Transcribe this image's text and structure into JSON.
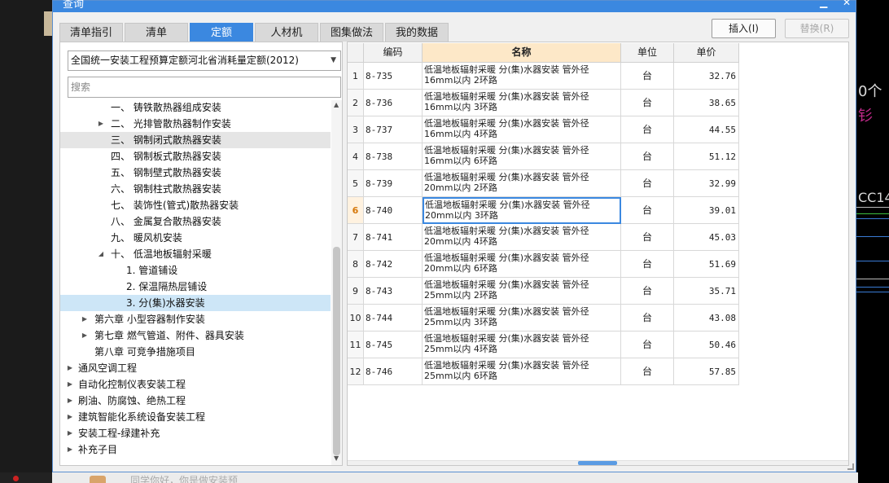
{
  "window": {
    "title": "查询"
  },
  "tabs": [
    {
      "label": "清单指引"
    },
    {
      "label": "清单"
    },
    {
      "label": "定额"
    },
    {
      "label": "人材机"
    },
    {
      "label": "图集做法"
    },
    {
      "label": "我的数据"
    }
  ],
  "active_tab": "定额",
  "buttons": {
    "insert": "插入(I)",
    "replace": "替换(R)"
  },
  "quota_selector": {
    "value": "全国统一安装工程预算定额河北省消耗量定额(2012)"
  },
  "search": {
    "placeholder": "搜索",
    "value": ""
  },
  "tree": [
    {
      "label": "一、 铸铁散热器组成安装",
      "expander": ""
    },
    {
      "label": "二、 光排管散热器制作安装",
      "expander": "collapsed"
    },
    {
      "label": "三、 钢制闭式散热器安装",
      "expander": "",
      "selected": true
    },
    {
      "label": "四、 钢制板式散热器安装",
      "expander": ""
    },
    {
      "label": "五、 钢制壁式散热器安装",
      "expander": ""
    },
    {
      "label": "六、 钢制柱式散热器安装",
      "expander": ""
    },
    {
      "label": "七、 装饰性(管式)散热器安装",
      "expander": ""
    },
    {
      "label": "八、 金属复合散热器安装",
      "expander": ""
    },
    {
      "label": "九、 暖风机安装",
      "expander": ""
    },
    {
      "label": "十、 低温地板辐射采暖",
      "expander": "expanded"
    },
    {
      "label": "1. 管道铺设",
      "expander": ""
    },
    {
      "label": "2. 保温隔热层铺设",
      "expander": ""
    },
    {
      "label": "3. 分(集)水器安装",
      "expander": "",
      "highlighted": true
    },
    {
      "label": "第六章 小型容器制作安装",
      "expander": "collapsed"
    },
    {
      "label": "第七章 燃气管道、附件、器具安装",
      "expander": "collapsed"
    },
    {
      "label": "第八章 可竞争措施项目",
      "expander": ""
    },
    {
      "label": "通风空调工程",
      "expander": "collapsed"
    },
    {
      "label": "自动化控制仪表安装工程",
      "expander": "collapsed"
    },
    {
      "label": "刷油、防腐蚀、绝热工程",
      "expander": "collapsed"
    },
    {
      "label": "建筑智能化系统设备安装工程",
      "expander": "collapsed"
    },
    {
      "label": "安装工程-绿建补充",
      "expander": "collapsed"
    },
    {
      "label": "补充子目",
      "expander": "collapsed"
    }
  ],
  "grid": {
    "columns": [
      {
        "label": ""
      },
      {
        "label": "编码"
      },
      {
        "label": "名称"
      },
      {
        "label": "单位"
      },
      {
        "label": "单价"
      }
    ],
    "current_row": "6",
    "rows": [
      {
        "index": "1",
        "code": "8-735",
        "name1": "低温地板辐射采暖 分(集)水器安装 管外径",
        "name2": "16mm以内 2环路",
        "unit": "台",
        "price": "32.76"
      },
      {
        "index": "2",
        "code": "8-736",
        "name1": "低温地板辐射采暖 分(集)水器安装 管外径",
        "name2": "16mm以内 3环路",
        "unit": "台",
        "price": "38.65"
      },
      {
        "index": "3",
        "code": "8-737",
        "name1": "低温地板辐射采暖 分(集)水器安装 管外径",
        "name2": "16mm以内 4环路",
        "unit": "台",
        "price": "44.55"
      },
      {
        "index": "4",
        "code": "8-738",
        "name1": "低温地板辐射采暖 分(集)水器安装 管外径",
        "name2": "16mm以内 6环路",
        "unit": "台",
        "price": "51.12"
      },
      {
        "index": "5",
        "code": "8-739",
        "name1": "低温地板辐射采暖 分(集)水器安装 管外径",
        "name2": "20mm以内 2环路",
        "unit": "台",
        "price": "32.99"
      },
      {
        "index": "6",
        "code": "8-740",
        "name1": "低温地板辐射采暖 分(集)水器安装 管外径",
        "name2": "20mm以内 3环路",
        "unit": "台",
        "price": "39.01"
      },
      {
        "index": "7",
        "code": "8-741",
        "name1": "低温地板辐射采暖 分(集)水器安装 管外径",
        "name2": "20mm以内 4环路",
        "unit": "台",
        "price": "45.03"
      },
      {
        "index": "8",
        "code": "8-742",
        "name1": "低温地板辐射采暖 分(集)水器安装 管外径",
        "name2": "20mm以内 6环路",
        "unit": "台",
        "price": "51.69"
      },
      {
        "index": "9",
        "code": "8-743",
        "name1": "低温地板辐射采暖 分(集)水器安装 管外径",
        "name2": "25mm以内 2环路",
        "unit": "台",
        "price": "35.71"
      },
      {
        "index": "10",
        "code": "8-744",
        "name1": "低温地板辐射采暖 分(集)水器安装 管外径",
        "name2": "25mm以内 3环路",
        "unit": "台",
        "price": "43.08"
      },
      {
        "index": "11",
        "code": "8-745",
        "name1": "低温地板辐射采暖 分(集)水器安装 管外径",
        "name2": "25mm以内 4环路",
        "unit": "台",
        "price": "50.46"
      },
      {
        "index": "12",
        "code": "8-746",
        "name1": "低温地板辐射采暖 分(集)水器安装 管外径",
        "name2": "25mm以内 6环路",
        "unit": "台",
        "price": "57.85"
      }
    ]
  },
  "background": {
    "right_text_1": "0个",
    "right_text_2": "钐",
    "right_text_3": "CC14",
    "chat_text": "同学你好，你是做安装预"
  },
  "colors": {
    "accent": "#3b88e0",
    "name_header": "#fde8c8",
    "tree_highlight": "#cde6f7",
    "current_index": "#d6780a"
  }
}
